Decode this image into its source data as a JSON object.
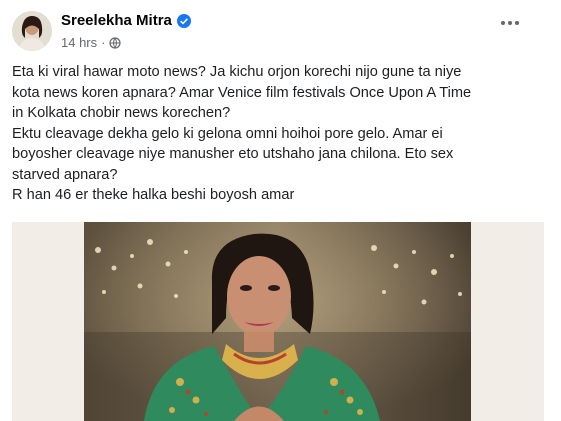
{
  "post": {
    "author": "Sreelekha Mitra",
    "time": "14 hrs",
    "separator": "·",
    "lines": [
      "Eta ki viral hawar moto news? Ja kichu orjon korechi nijo gune ta niye",
      "kota news koren apnara? Amar Venice film festivals Once Upon A Time",
      "in Kolkata chobir news korechen?",
      "Ektu cleavage dekha gelo ki gelona omni hoihoi pore gelo. Amar ei",
      "boyosher cleavage niye manusher eto utshaho jana chilona. Eto sex",
      "starved apnara?",
      "R han 46 er theke halka beshi boyosh amar"
    ]
  },
  "icons": {
    "verified": "verified-badge-icon",
    "privacy": "globe-icon",
    "more": "more-options-icon"
  },
  "colors": {
    "accent": "#1877f2",
    "meta": "#65676b",
    "text": "#1c1e21"
  }
}
